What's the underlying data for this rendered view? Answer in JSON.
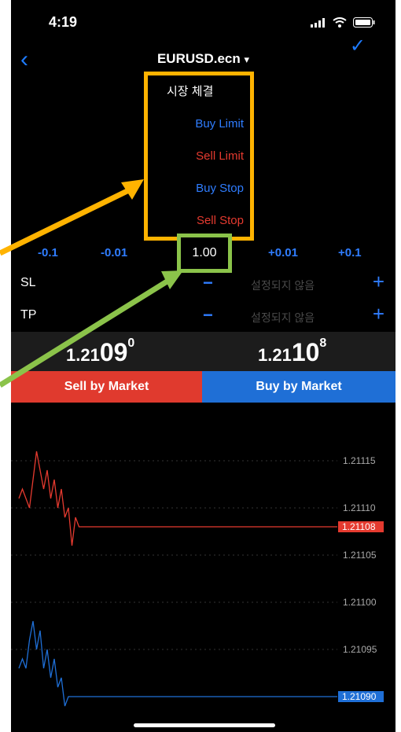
{
  "status_bar": {
    "time": "4:19"
  },
  "nav": {
    "title": "EURUSD.ecn",
    "dropdown_arrow": "▾"
  },
  "order_types": {
    "market": "시장 체결",
    "items": [
      {
        "label": "Buy Limit",
        "color": "#2f7dff"
      },
      {
        "label": "Sell Limit",
        "color": "#e53a2f"
      },
      {
        "label": "Buy Stop",
        "color": "#2f7dff"
      },
      {
        "label": "Sell Stop",
        "color": "#e53a2f"
      }
    ]
  },
  "volume": {
    "minus_big": "-0.1",
    "minus_small": "-0.01",
    "value": "1.00",
    "plus_small": "+0.01",
    "plus_big": "+0.1"
  },
  "sl": {
    "label": "SL",
    "value": "설정되지 않음",
    "minus": "−",
    "plus": "+"
  },
  "tp": {
    "label": "TP",
    "value": "설정되지 않음",
    "minus": "−",
    "plus": "+"
  },
  "quotes": {
    "sell": {
      "prefix": "1.21",
      "big": "09",
      "sup": "0"
    },
    "buy": {
      "prefix": "1.21",
      "big": "10",
      "sup": "8"
    }
  },
  "buttons": {
    "sell": "Sell by Market",
    "buy": "Buy by Market"
  },
  "chart_data": {
    "type": "line",
    "price_labels": [
      "1.21115",
      "1.21110",
      "1.21105",
      "1.21100",
      "1.21095"
    ],
    "ylim": [
      1.21088,
      1.21118
    ],
    "series": [
      {
        "color": "#e53a2f",
        "current": "1.21108",
        "values": [
          1.21111,
          1.21112,
          1.21111,
          1.2111,
          1.21113,
          1.21116,
          1.21114,
          1.21112,
          1.21114,
          1.21111,
          1.21113,
          1.2111,
          1.21112,
          1.21109,
          1.2111,
          1.21106,
          1.21109,
          1.21108
        ]
      },
      {
        "color": "#1f6fd6",
        "current": "1.21090",
        "values": [
          1.21093,
          1.21094,
          1.21093,
          1.21096,
          1.21098,
          1.21095,
          1.21097,
          1.21093,
          1.21095,
          1.21092,
          1.21094,
          1.21091,
          1.21092,
          1.21089,
          1.2109
        ]
      }
    ]
  },
  "colors": {
    "accent_blue": "#1e7bff",
    "annotation_orange": "#ffb300",
    "annotation_green": "#8bc34a"
  }
}
